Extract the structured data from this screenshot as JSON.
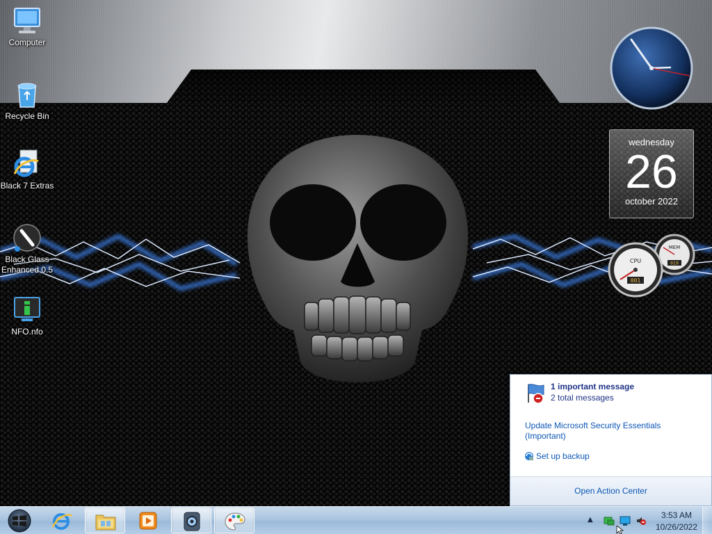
{
  "desktop_icons": [
    {
      "label": "Computer"
    },
    {
      "label": "Recycle Bin"
    },
    {
      "label": "Black 7 Extras"
    },
    {
      "label": "Black Glass Enhanced 0.5"
    },
    {
      "label": "NFO.nfo"
    }
  ],
  "calendar": {
    "day_name": "wednesday",
    "date": "26",
    "month_year": "october 2022"
  },
  "meter": {
    "cpu_label": "CPU",
    "mem_label": "MEM",
    "cpu_value": "001",
    "mem_value": "019"
  },
  "action_center": {
    "important": "1 important message",
    "total": "2 total messages",
    "update": "Update Microsoft Security Essentials (Important)",
    "backup": "Set up backup",
    "open": "Open Action Center"
  },
  "tray": {
    "time": "3:53 AM",
    "date": "10/26/2022",
    "arrow": "▲"
  },
  "colors": {
    "link": "#0b56b6",
    "heading": "#1e3287",
    "taskbar": "#a9c4e0"
  }
}
